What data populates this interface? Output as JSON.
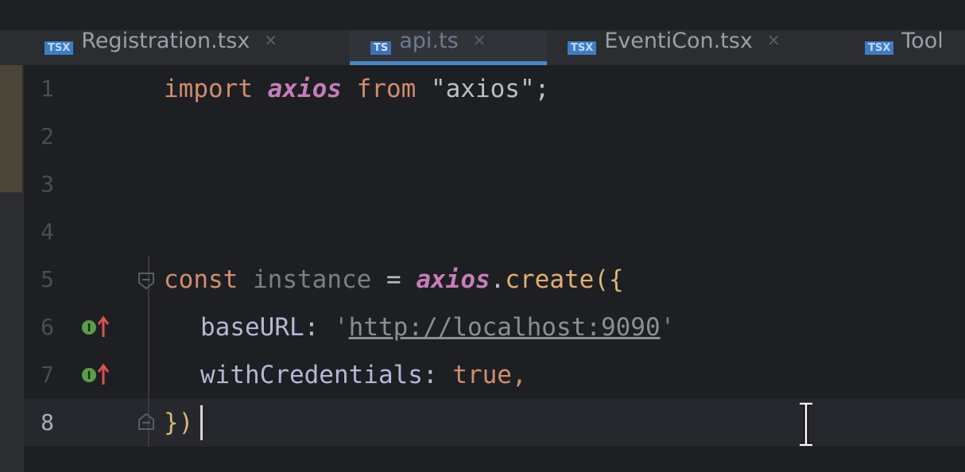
{
  "tabs": [
    {
      "badge": "TSX",
      "name": "Registration.tsx",
      "close": "×",
      "active": false
    },
    {
      "badge": "TS",
      "name": "api.ts",
      "close": "×",
      "active": true
    },
    {
      "badge": "TSX",
      "name": "EventiCon.tsx",
      "close": "×",
      "active": false
    },
    {
      "badge": "TSX",
      "name": "Tool",
      "close": "",
      "active": false
    }
  ],
  "line_numbers": [
    "1",
    "2",
    "3",
    "4",
    "5",
    "6",
    "7",
    "8"
  ],
  "code": {
    "l1": {
      "kw": "import",
      "mod": "axios",
      "from": "from",
      "str": "\"axios\";"
    },
    "l5": {
      "kw": "const",
      "var": "instance",
      "eq": "=",
      "obj": "axios",
      "dot": ".",
      "fn": "create",
      "open": "({"
    },
    "l6": {
      "key": "baseURL",
      "colon": ":",
      "q1": "'",
      "url": "http://localhost:9090",
      "q2": "'"
    },
    "l7": {
      "key": "withCredentials",
      "colon": ":",
      "val": "true",
      "comma": ","
    },
    "l8": {
      "close": "})"
    }
  },
  "icons": {
    "fold": "fold-icon",
    "implement": "implementing-icon",
    "ibeam": "text-cursor-icon"
  },
  "colors": {
    "keyword": "#cf8e6d",
    "string": "#6aab73",
    "accent": "#4a86c9"
  }
}
